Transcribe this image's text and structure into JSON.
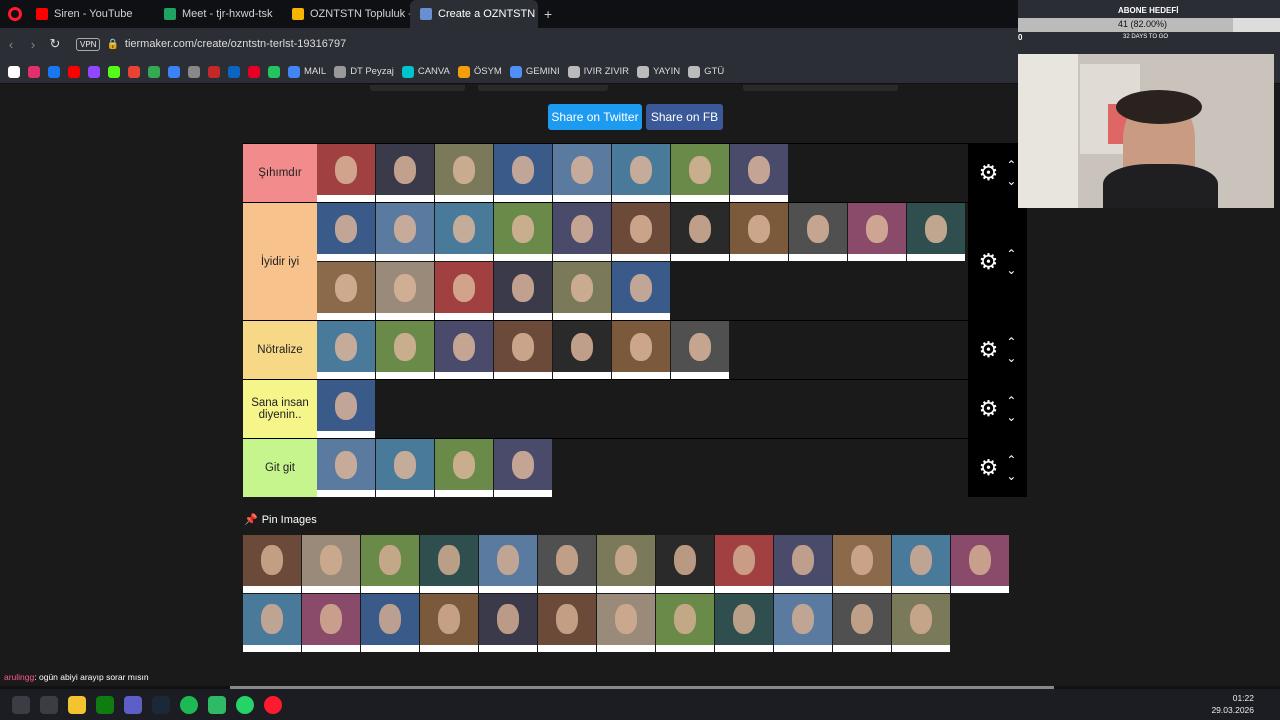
{
  "browser": {
    "tabs": [
      {
        "label": "Siren - YouTube",
        "color": "#ff0000",
        "active": false
      },
      {
        "label": "Meet - tjr-hxwd-tsk",
        "color": "#1ea362",
        "active": false
      },
      {
        "label": "OZNTSTN Topluluk - Tier l",
        "color": "#f5b400",
        "active": false
      },
      {
        "label": "Create a OZNTSTN TIERLI",
        "color": "#6a8fd1",
        "active": true
      }
    ],
    "url": "tiermaker.com/create/ozntstn-terlst-19316797",
    "vpn": "VPN"
  },
  "bookmarks": [
    {
      "label": "",
      "color": "#fff"
    },
    {
      "label": "",
      "color": "#e1306c"
    },
    {
      "label": "",
      "color": "#1877f2"
    },
    {
      "label": "",
      "color": "#ff0000"
    },
    {
      "label": "",
      "color": "#9146ff"
    },
    {
      "label": "",
      "color": "#53fc18"
    },
    {
      "label": "",
      "color": "#ea4335"
    },
    {
      "label": "",
      "color": "#34a853"
    },
    {
      "label": "",
      "color": "#3b82f6"
    },
    {
      "label": "",
      "color": "#888"
    },
    {
      "label": "",
      "color": "#c62828"
    },
    {
      "label": "",
      "color": "#0a66c2"
    },
    {
      "label": "",
      "color": "#e60023"
    },
    {
      "label": "",
      "color": "#22c55e"
    },
    {
      "label": "MAIL",
      "color": "#4285f4"
    },
    {
      "label": "DT Peyzaj",
      "color": "#999"
    },
    {
      "label": "CANVA",
      "color": "#00c4cc"
    },
    {
      "label": "ÖSYM",
      "color": "#f59e0b"
    },
    {
      "label": "GEMINI",
      "color": "#4f8ff7"
    },
    {
      "label": "IVIR ZIVIR",
      "color": "#bbb"
    },
    {
      "label": "YAYIN",
      "color": "#bbb"
    },
    {
      "label": "GTÜ",
      "color": "#bbb"
    }
  ],
  "share": {
    "twitter": "Share on Twitter",
    "fb": "Share on FB"
  },
  "tiers": [
    {
      "label": "Şıhımdır",
      "color": "#f28c8c"
    },
    {
      "label": "İyidir iyi",
      "color": "#f7c28b"
    },
    {
      "label": "Nötralize",
      "color": "#f7d886"
    },
    {
      "label": "Sana insan diyenin..",
      "color": "#f5f58a"
    },
    {
      "label": "Git git",
      "color": "#c6f58d"
    }
  ],
  "pin_label": "Pin Images",
  "chat": [
    {
      "user": "arulingg",
      "msg": "ogün abiyi arayıp sorar mısın"
    }
  ],
  "overlay": {
    "goal_title": "ABONE HEDEFİ",
    "goal_value": "41 (82.00%)",
    "goal_fraction": 0.82,
    "goal_start": "0",
    "days": "32 DAYS TO GO"
  },
  "clock": {
    "time": "01:22",
    "date": "29.03.2026"
  }
}
